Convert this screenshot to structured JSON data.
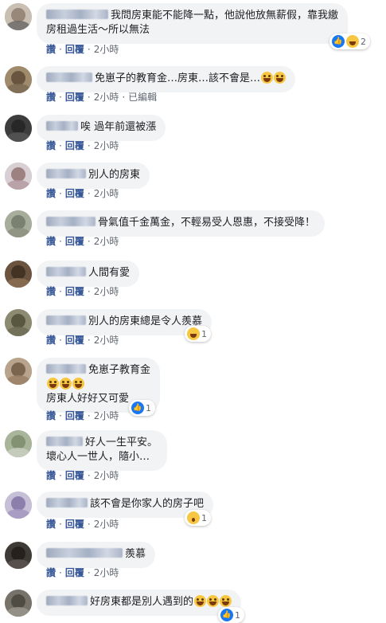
{
  "colors": {
    "link": "#385898",
    "bubble": "#f2f3f5",
    "text": "#1c1e21",
    "meta": "#606770",
    "like": "#1877f2"
  },
  "action_labels": {
    "like": "讚",
    "reply": "回覆",
    "edited": "已編輯"
  },
  "comments": [
    {
      "lines": [
        "我問房東能不能降一點，他說他放無薪假，靠我繳",
        "房租過生活～所以無法"
      ],
      "time": "2小時",
      "reactions": [
        "like-icon",
        "haha-icon"
      ],
      "reaction_count": "2"
    },
    {
      "lines": [
        "免崽子的教育金…房東…該不會是…"
      ],
      "time": "2小時",
      "edited": true
    },
    {
      "lines": [
        "唉 過年前還被漲"
      ],
      "time": "2小時"
    },
    {
      "lines": [
        "別人的房東"
      ],
      "time": "2小時"
    },
    {
      "lines": [
        "骨氣值千金萬金，不輕易受人恩惠，不接受降！"
      ],
      "time": "2小時"
    },
    {
      "lines": [
        "人間有愛"
      ],
      "time": "2小時"
    },
    {
      "lines": [
        "別人的房東總是令人羨慕"
      ],
      "time": "2小時",
      "reactions": [
        "haha-icon"
      ],
      "reaction_count": "1"
    },
    {
      "lines": [
        "免崽子教育金",
        "",
        "房東人好好又可愛"
      ],
      "time": "2小時",
      "reactions": [
        "like-icon"
      ],
      "reaction_count": "1"
    },
    {
      "lines": [
        "好人一生平安。",
        "壞心人一世人，隨小…"
      ],
      "time": "2小時"
    },
    {
      "lines": [
        "該不會是你家人的房子吧"
      ],
      "time": "2小時",
      "reactions": [
        "wow-icon"
      ],
      "reaction_count": "1"
    },
    {
      "lines": [
        "羨慕"
      ],
      "time": "2小時"
    },
    {
      "lines": [
        "好房東都是別人遇到的"
      ],
      "time": "2小時",
      "reactions": [
        "like-icon"
      ],
      "reaction_count": "1"
    }
  ]
}
